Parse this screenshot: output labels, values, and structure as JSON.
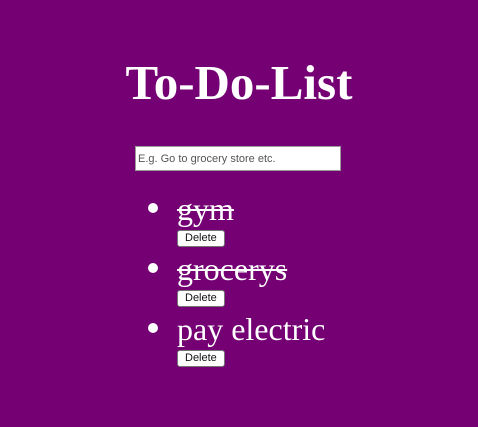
{
  "app": {
    "title": "To-Do-List"
  },
  "input": {
    "placeholder": "E.g. Go to grocery store etc.",
    "value": ""
  },
  "tasks": [
    {
      "text": "gym",
      "done": true,
      "delete_label": "Delete"
    },
    {
      "text": "grocerys",
      "done": true,
      "delete_label": "Delete"
    },
    {
      "text": "pay electric",
      "done": false,
      "delete_label": "Delete"
    }
  ],
  "colors": {
    "background": "#740074",
    "text": "#ffffff"
  }
}
